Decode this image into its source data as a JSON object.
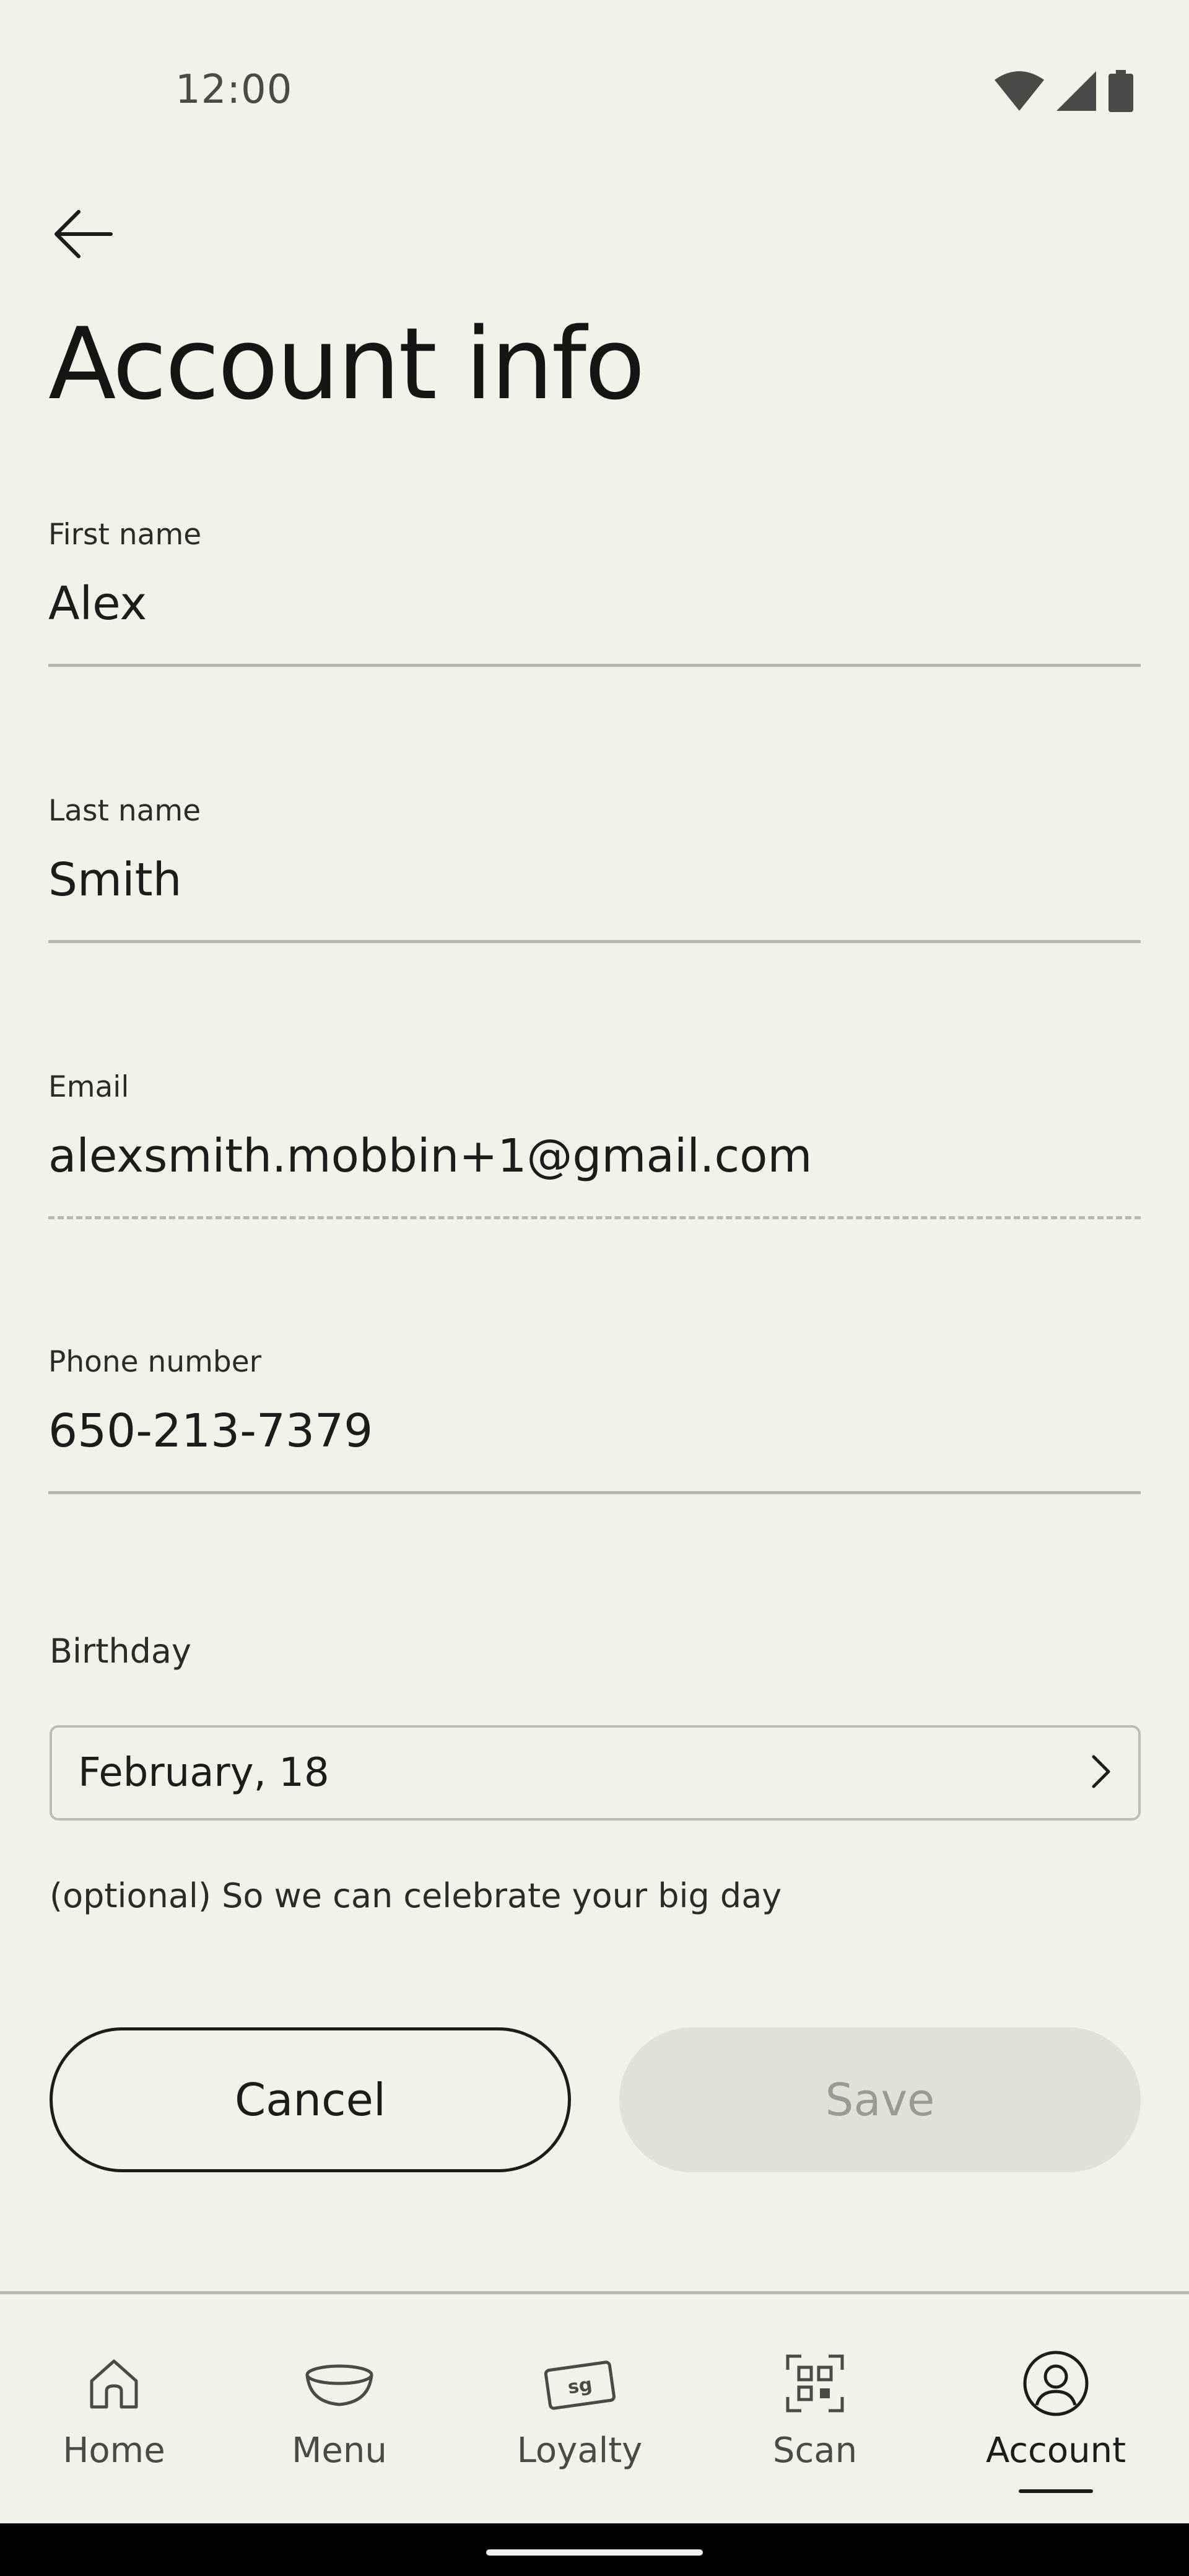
{
  "status_bar": {
    "time": "12:00",
    "icons": [
      "wifi-icon",
      "signal-icon",
      "battery-icon"
    ]
  },
  "header": {
    "back_icon": "arrow-left-icon",
    "title": "Account info"
  },
  "form": {
    "first_name": {
      "label": "First name",
      "value": "Alex"
    },
    "last_name": {
      "label": "Last name",
      "value": "Smith"
    },
    "email": {
      "label": "Email",
      "value": "alexsmith.mobbin+1@gmail.com",
      "editable": false
    },
    "phone": {
      "label": "Phone number",
      "value": "650-213-7379"
    },
    "birthday": {
      "label": "Birthday",
      "value": "February, 18",
      "helper": "(optional) So we can celebrate your big day"
    }
  },
  "actions": {
    "cancel_label": "Cancel",
    "save_label": "Save",
    "save_enabled": false
  },
  "bottom_nav": {
    "items": [
      {
        "label": "Home",
        "icon": "home-icon"
      },
      {
        "label": "Menu",
        "icon": "bowl-icon"
      },
      {
        "label": "Loyalty",
        "icon": "loyalty-card-icon"
      },
      {
        "label": "Scan",
        "icon": "qr-scan-icon"
      },
      {
        "label": "Account",
        "icon": "account-icon",
        "active": true
      }
    ]
  },
  "colors": {
    "background": "#f3f2e9",
    "text": "#1c1c1a",
    "divider": "#b8b8b2",
    "disabled_button": "#e2e1d8",
    "disabled_text": "#9a9a94"
  }
}
